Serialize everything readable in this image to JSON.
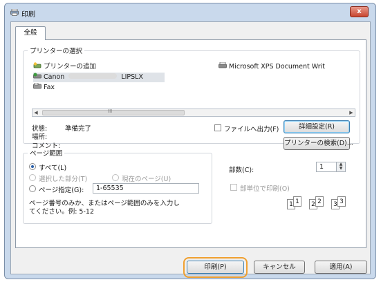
{
  "window": {
    "title": "印刷",
    "close_glyph": "x"
  },
  "tabs": [
    {
      "label": "全般"
    }
  ],
  "printer_select": {
    "legend": "プリンターの選択",
    "add_printer": "プリンターの追加",
    "canon_prefix": "Canon",
    "canon_model": "LIPSLX",
    "fax": "Fax",
    "xps": "Microsoft XPS Document Writ",
    "scroll_mark": "III",
    "status_label": "状態:",
    "status_value": "準備完了",
    "location_label": "場所:",
    "comment_label": "コメント:",
    "print_to_file": "ファイルへ出力(F)",
    "preferences_button": "詳細設定(R)",
    "find_printer_button": "プリンターの検索(D)..."
  },
  "page_range": {
    "legend": "ページ範囲",
    "all": "すべて(L)",
    "selection": "選択した部分(T)",
    "current_page": "現在のページ(U)",
    "pages": "ページ指定(G):",
    "pages_value": "1-65535",
    "hint_line1": "ページ番号のみか、またはページ範囲のみを入力し",
    "hint_line2": "てください。例: 5-12"
  },
  "copies": {
    "label": "部数(C):",
    "value": "1",
    "collate": "部単位で印刷(O)",
    "collate_pages": [
      "1",
      "1",
      "2",
      "2",
      "3",
      "3"
    ]
  },
  "footer": {
    "print_button": "印刷(P)",
    "cancel_button": "キャンセル",
    "apply_button": "適用(A)"
  }
}
